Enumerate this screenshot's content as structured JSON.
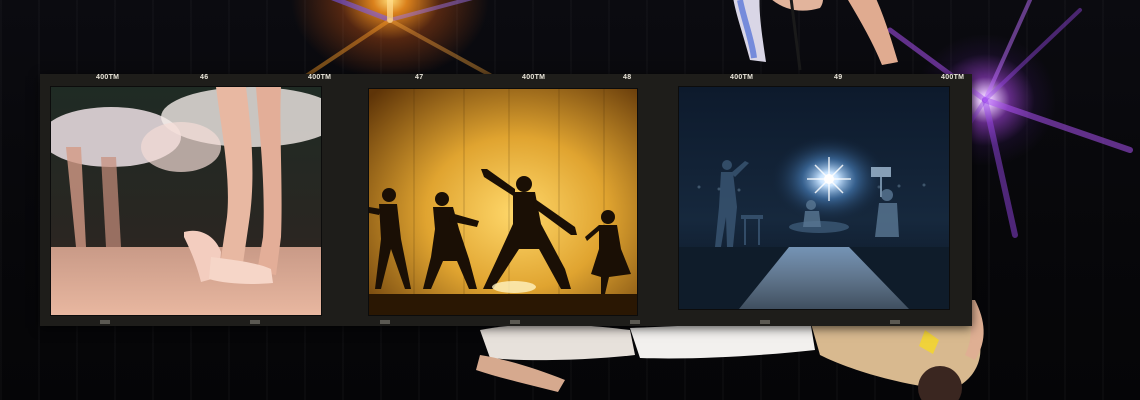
{
  "scene": {
    "description_colors": {
      "background": "#050507",
      "film_base": "#1e1d1a",
      "edge_text": "#e9e5da",
      "flare_orange": "#ff9a2a",
      "flare_purple": "#b45cff"
    }
  },
  "filmstrip": {
    "edge_labels": [
      "400TM",
      "46",
      "400TM",
      "47",
      "400TM",
      "48",
      "400TM",
      "49",
      "400TM"
    ],
    "frames": [
      {
        "icon": "ballet-feet-photo"
      },
      {
        "icon": "dancer-silhouettes-photo"
      },
      {
        "icon": "stage-spotlight-photo"
      }
    ]
  }
}
